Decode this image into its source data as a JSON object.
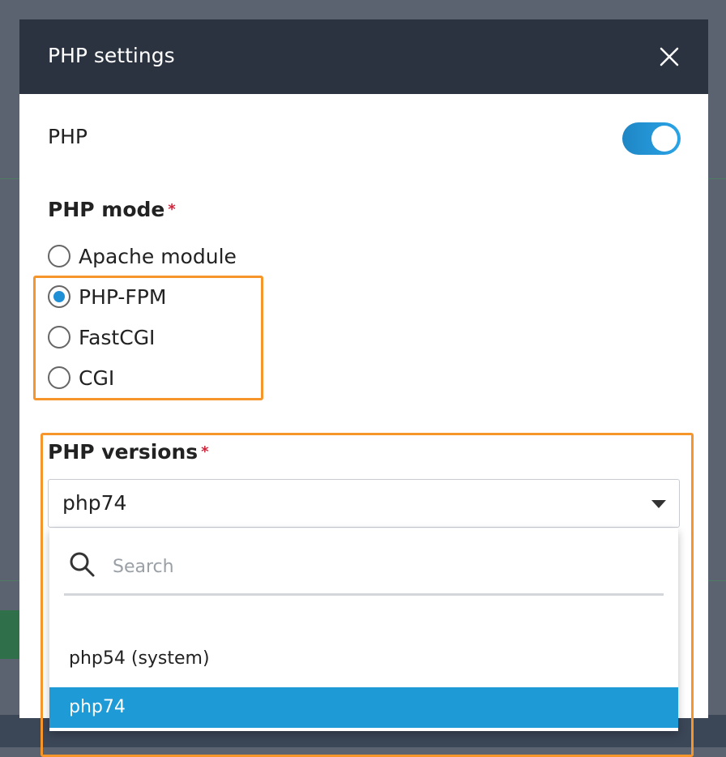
{
  "modal": {
    "title": "PHP settings",
    "php_toggle": {
      "label": "PHP",
      "enabled": true
    },
    "php_mode": {
      "label": "PHP mode",
      "required_marker": "*",
      "options": [
        {
          "label": "Apache module",
          "selected": false
        },
        {
          "label": "PHP-FPM",
          "selected": true
        },
        {
          "label": "FastCGI",
          "selected": false
        },
        {
          "label": "CGI",
          "selected": false
        }
      ]
    },
    "php_versions": {
      "label": "PHP versions",
      "required_marker": "*",
      "selected_value": "php74",
      "search_placeholder": "Search",
      "options": [
        {
          "label": "php54 (system)",
          "selected": false
        },
        {
          "label": "php74",
          "selected": true
        }
      ]
    }
  },
  "colors": {
    "header_bg": "#2b3341",
    "accent": "#1e9ad6",
    "highlight_border": "#f6952a",
    "required": "#d0243b"
  },
  "icons": {
    "close": "close-icon",
    "search": "search-icon",
    "caret": "chevron-down-icon"
  }
}
